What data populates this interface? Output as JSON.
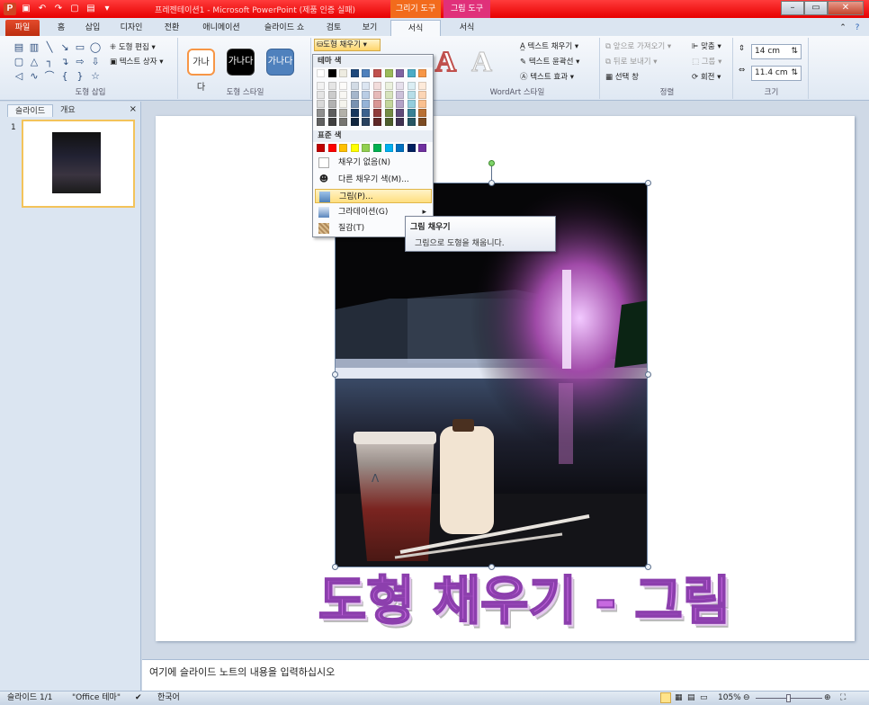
{
  "window": {
    "title": "프레젠테이션1 - Microsoft PowerPoint (제품 인증 실패)",
    "app_letter": "P",
    "context_tab_drawing": "그리기 도구",
    "context_tab_picture": "그림 도구",
    "title_bar_color": "#e80000",
    "min": "–",
    "max": "▭",
    "close": "✕"
  },
  "tabs": {
    "file": "파일",
    "home": "홈",
    "insert": "삽입",
    "design": "디자인",
    "transitions": "전환",
    "animations": "애니메이션",
    "slideshow": "슬라이드 쇼",
    "review": "검토",
    "view": "보기",
    "format_drawing": "서식",
    "format_picture": "서식"
  },
  "ribbon": {
    "insert_shapes": {
      "label": "도형 삽입",
      "edit_shape": "도형 편집",
      "text_box": "텍스트 상자"
    },
    "shape_styles": {
      "label": "도형 스타일",
      "sample": "가나다",
      "fill": "도형 채우기"
    },
    "wordart": {
      "label": "WordArt 스타일",
      "text_fill": "텍스트 채우기",
      "text_outline": "텍스트 윤곽선",
      "text_effects": "텍스트 효과"
    },
    "arrange": {
      "label": "정렬",
      "bring_forward": "앞으로 가져오기",
      "send_backward": "뒤로 보내기",
      "selection_pane": "선택 창",
      "align": "맞춤",
      "group": "그룹",
      "rotate": "회전"
    },
    "size": {
      "label": "크기",
      "height": "14 cm",
      "width": "11.4 cm"
    }
  },
  "fill_menu": {
    "theme_colors": "테마 색",
    "standard_colors": "표준 색",
    "no_fill": "채우기 없음(N)",
    "more_colors": "다른 채우기 색(M)...",
    "picture": "그림(P)...",
    "gradient": "그라데이션(G)",
    "texture": "질감(T)",
    "theme_top": [
      "#ffffff",
      "#000000",
      "#eeece1",
      "#1f497d",
      "#4f81bd",
      "#c0504d",
      "#9bbb59",
      "#8064a2",
      "#4bacc6",
      "#f79646"
    ],
    "standard": [
      "#c00000",
      "#ff0000",
      "#ffc000",
      "#ffff00",
      "#92d050",
      "#00b050",
      "#00b0f0",
      "#0070c0",
      "#002060",
      "#7030a0"
    ]
  },
  "tooltip": {
    "title": "그림 채우기",
    "body": "그림으로 도형을 채웁니다."
  },
  "pane": {
    "tab_slides": "슬라이드",
    "tab_outline": "개요",
    "close": "×",
    "slide_number": "1"
  },
  "slide": {
    "title_text": "도형 채우기 - 그림"
  },
  "notes": {
    "placeholder": "여기에 슬라이드 노트의 내용을 입력하십시오"
  },
  "status": {
    "slide_info": "슬라이드 1/1",
    "theme": "\"Office 테마\"",
    "language": "한국어",
    "zoom": "105%"
  }
}
